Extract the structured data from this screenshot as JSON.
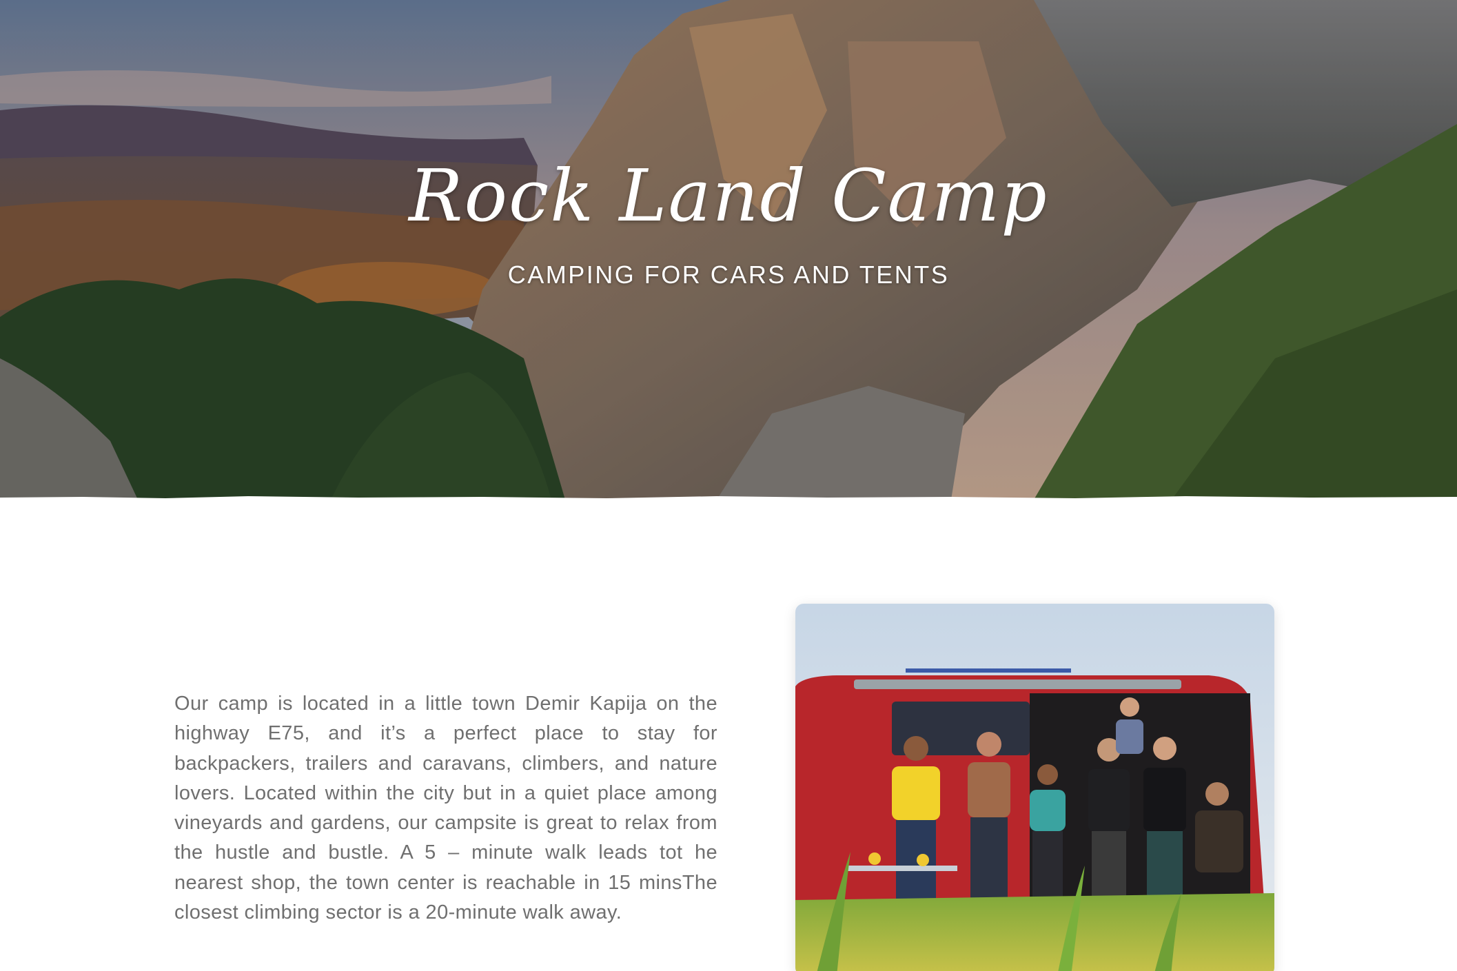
{
  "hero": {
    "title": "Rock Land Camp",
    "subtitle": "CAMPING FOR CARS AND TENTS"
  },
  "about": {
    "description": "Our camp is located in a little town Demir Kapija on the highway E75, and it’s a perfect place to stay for backpackers, trailers and caravans, climbers, and nature lovers. Located within the city but in a quiet place among vineyards and gardens, our campsite is great to relax from the hustle and bustle. A 5 – minute walk leads tot he nearest shop, the town center is reachable in 15 minsThe closest climbing sector is a 20-minute walk away."
  },
  "colors": {
    "text_body": "#6f6f6f",
    "hero_text": "#ffffff",
    "background": "#ffffff"
  }
}
